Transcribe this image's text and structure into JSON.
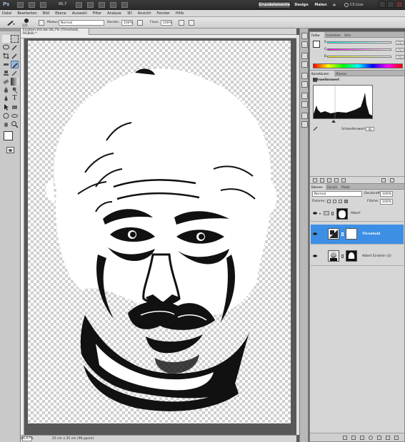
{
  "app": {
    "logo": "Ps",
    "zoom": "66,7",
    "workspaces": [
      "Grundelemente",
      "Design",
      "Malen"
    ],
    "more": "»",
    "cs_live": "CS Live"
  },
  "menu": [
    "Datei",
    "Bearbeiten",
    "Bild",
    "Ebene",
    "Auswahl",
    "Filter",
    "Analyse",
    "3D",
    "Ansicht",
    "Fenster",
    "Hilfe"
  ],
  "options": {
    "size": "125",
    "mode_label": "Modus:",
    "mode_value": "Normal",
    "opacity_label": "Deckkr.:",
    "opacity_value": "100%",
    "flow_label": "Fluss:",
    "flow_value": "100%"
  },
  "document": {
    "tab_title": "Einstein.tmt bei 66,7% (Threshold, RGB/8) *",
    "status_zoom": "66,67%",
    "status_info": "25 cm x 35 cm (96 ppcm)"
  },
  "color_panel": {
    "tabs": [
      "Farbe",
      "Farbfelder",
      "Stile"
    ],
    "channels": [
      {
        "label": "R",
        "value": "255"
      },
      {
        "label": "G",
        "value": "255"
      },
      {
        "label": "B",
        "value": "255"
      }
    ]
  },
  "adjust_panel": {
    "tabs": [
      "Korrekturen",
      "Masken"
    ],
    "title": "Schwellenwert",
    "threshold_label": "Schwellenwert:",
    "threshold_value": "95"
  },
  "layers_panel": {
    "tabs": [
      "Ebenen",
      "Kanäle",
      "Pfade"
    ],
    "blend_mode": "Normal",
    "opacity_label": "Deckkraft:",
    "opacity_value": "100%",
    "lock_label": "Fixieren:",
    "fill_label": "Fläche:",
    "fill_value": "100%",
    "layers": [
      {
        "name": "Albert",
        "selected": false
      },
      {
        "name": "Threshold",
        "selected": true
      },
      {
        "name": "Albert Einstein (2)",
        "selected": false
      }
    ]
  },
  "colors": {
    "accent_selected": "#3d8fe6",
    "app_bar": "#2f2f2f"
  }
}
